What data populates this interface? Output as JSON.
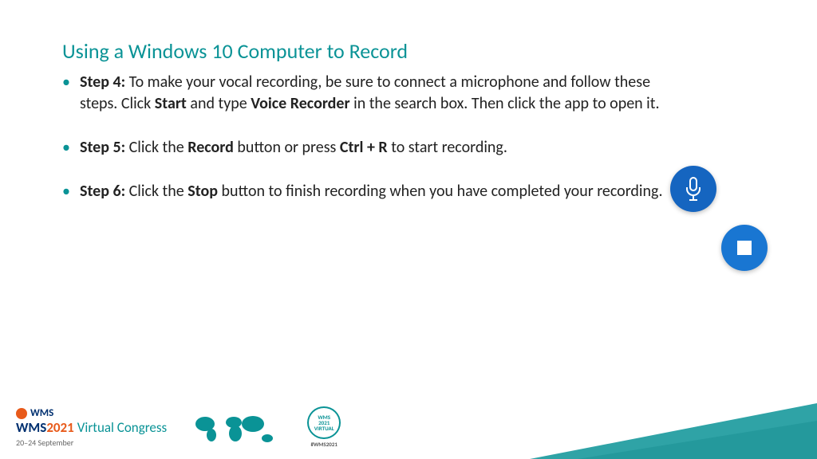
{
  "title": "Using a Windows 10 Computer to Record",
  "steps": {
    "s4": {
      "label": "Step 4:",
      "pre": " To make your vocal recording, be sure to connect a microphone and follow these steps.  Click ",
      "b1": "Start",
      "mid1": " and type ",
      "b2": "Voice Recorder",
      "post": " in the search box.  Then click the app to open it."
    },
    "s5": {
      "label": "Step 5:",
      "pre": " Click the ",
      "b1": "Record",
      "mid1": " button or press ",
      "b2": "Ctrl + R",
      "post": " to start recording."
    },
    "s6": {
      "label": "Step 6:",
      "pre": " Click the ",
      "b1": "Stop",
      "post": " button to finish recording when you have completed your recording."
    }
  },
  "footer": {
    "wms": "WMS",
    "brand": "WMS",
    "year": "2021",
    "congress": "Virtual Congress",
    "dates": "20–24 September",
    "badge_l1": "WMS",
    "badge_l2": "2021",
    "badge_l3": "VIRTUAL",
    "hash": "#WMS2021"
  }
}
